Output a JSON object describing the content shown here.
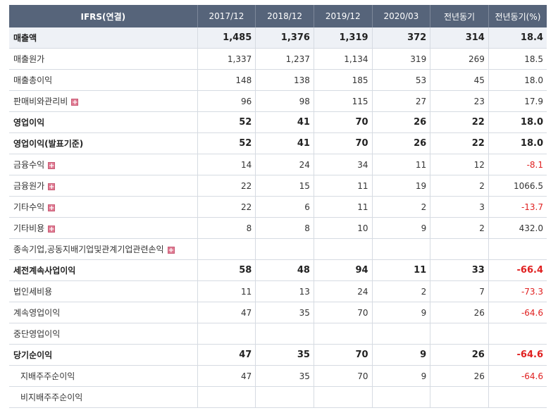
{
  "header": {
    "label": "IFRS(연결)",
    "columns": [
      "2017/12",
      "2018/12",
      "2019/12",
      "2020/03",
      "전년동기",
      "전년동기(%)"
    ]
  },
  "rows": [
    {
      "label": "매출액",
      "values": [
        "1,485",
        "1,376",
        "1,319",
        "372",
        "314",
        "18.4"
      ]
    },
    {
      "label": "매출원가",
      "values": [
        "1,337",
        "1,237",
        "1,134",
        "319",
        "269",
        "18.5"
      ]
    },
    {
      "label": "매출총이익",
      "values": [
        "148",
        "138",
        "185",
        "53",
        "45",
        "18.0"
      ]
    },
    {
      "label": "판매비와관리비",
      "values": [
        "96",
        "98",
        "115",
        "27",
        "23",
        "17.9"
      ]
    },
    {
      "label": "영업이익",
      "values": [
        "52",
        "41",
        "70",
        "26",
        "22",
        "18.0"
      ]
    },
    {
      "label": "영업이익(발표기준)",
      "values": [
        "52",
        "41",
        "70",
        "26",
        "22",
        "18.0"
      ]
    },
    {
      "label": "금융수익",
      "values": [
        "14",
        "24",
        "34",
        "11",
        "12",
        "-8.1"
      ]
    },
    {
      "label": "금융원가",
      "values": [
        "22",
        "15",
        "11",
        "19",
        "2",
        "1066.5"
      ]
    },
    {
      "label": "기타수익",
      "values": [
        "22",
        "6",
        "11",
        "2",
        "3",
        "-13.7"
      ]
    },
    {
      "label": "기타비용",
      "values": [
        "8",
        "8",
        "10",
        "9",
        "2",
        "432.0"
      ]
    },
    {
      "label": "종속기업,공동지배기업및관계기업관련손익",
      "values": [
        "",
        "",
        "",
        "",
        "",
        ""
      ]
    },
    {
      "label": "세전계속사업이익",
      "values": [
        "58",
        "48",
        "94",
        "11",
        "33",
        "-66.4"
      ]
    },
    {
      "label": "법인세비용",
      "values": [
        "11",
        "13",
        "24",
        "2",
        "7",
        "-73.3"
      ]
    },
    {
      "label": "계속영업이익",
      "values": [
        "47",
        "35",
        "70",
        "9",
        "26",
        "-64.6"
      ]
    },
    {
      "label": "중단영업이익",
      "values": [
        "",
        "",
        "",
        "",
        "",
        ""
      ]
    },
    {
      "label": "당기순이익",
      "values": [
        "47",
        "35",
        "70",
        "9",
        "26",
        "-64.6"
      ]
    },
    {
      "label": "지배주주순이익",
      "values": [
        "47",
        "35",
        "70",
        "9",
        "26",
        "-64.6"
      ]
    },
    {
      "label": "비지배주주순이익",
      "values": [
        "",
        "",
        "",
        "",
        "",
        ""
      ]
    }
  ],
  "colors": {
    "header_bg": "#56647a",
    "negative": "#e02020",
    "expand_icon": "#e07b93"
  }
}
